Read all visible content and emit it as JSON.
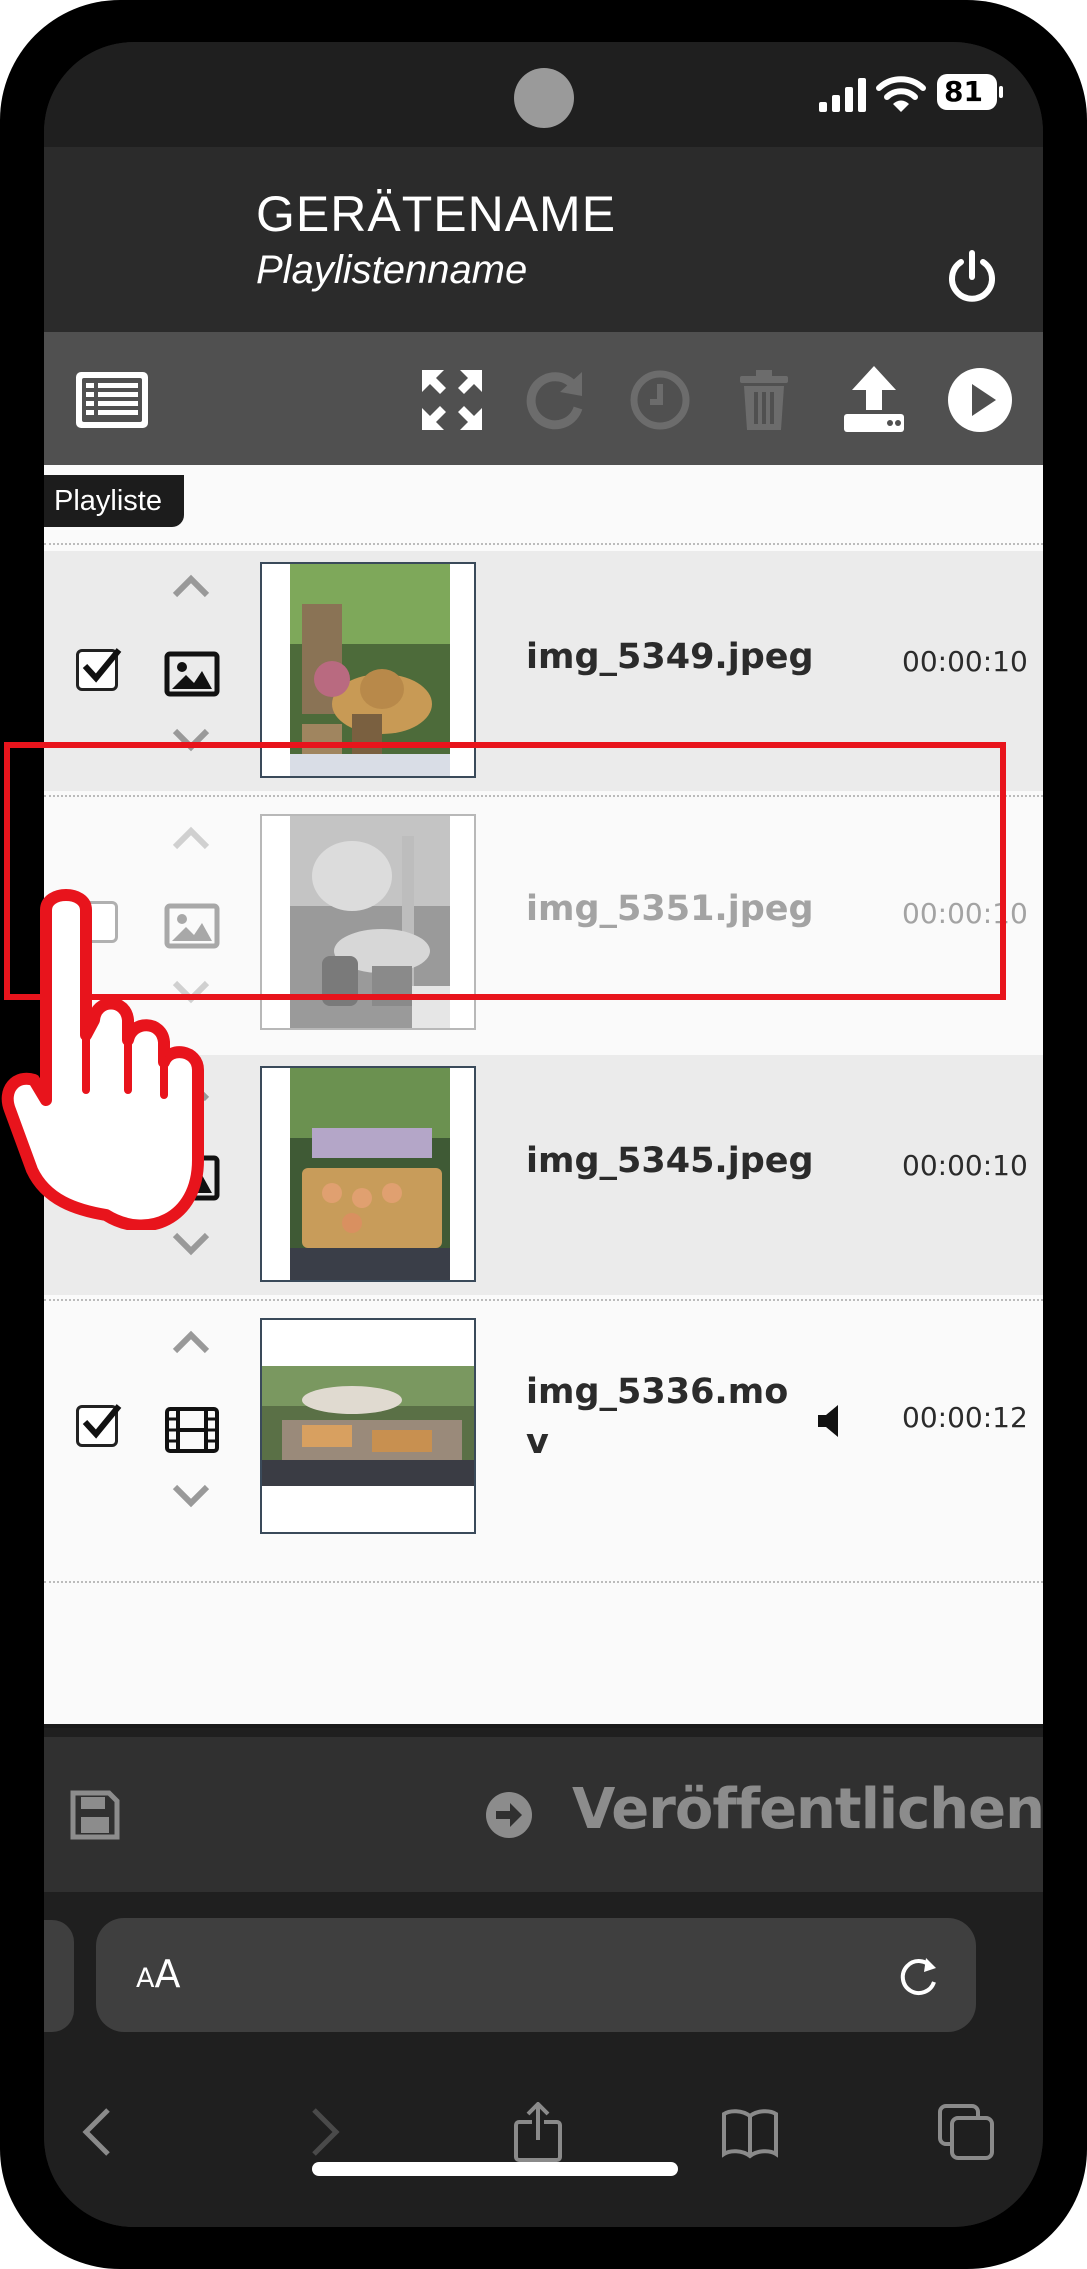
{
  "status_bar": {
    "battery": "81"
  },
  "header": {
    "device_name": "GERÄTENAME",
    "playlist_name": "Playlistenname"
  },
  "playlist_tag": "Playliste",
  "rows": [
    {
      "checked": true,
      "type": "image-icon",
      "filename": "img_5349.jpeg",
      "duration": "00:00:10",
      "disabled": false,
      "sound": false
    },
    {
      "checked": false,
      "type": "image-icon",
      "filename": "img_5351.jpeg",
      "duration": "00:00:10",
      "disabled": true,
      "sound": false
    },
    {
      "checked": true,
      "type": "image-icon",
      "filename": "img_5345.jpeg",
      "duration": "00:00:10",
      "disabled": false,
      "sound": false
    },
    {
      "checked": true,
      "type": "film-icon",
      "filename": "img_5336.mo\nv",
      "duration": "00:00:12",
      "disabled": false,
      "sound": true
    }
  ],
  "publish": {
    "label": "Veröffentlichen"
  },
  "browser": {
    "text_size_label": "AA"
  },
  "colors": {
    "accent_red": "#e8141c",
    "header_bg": "#2b2b2b",
    "toolbar_bg": "#505050"
  }
}
